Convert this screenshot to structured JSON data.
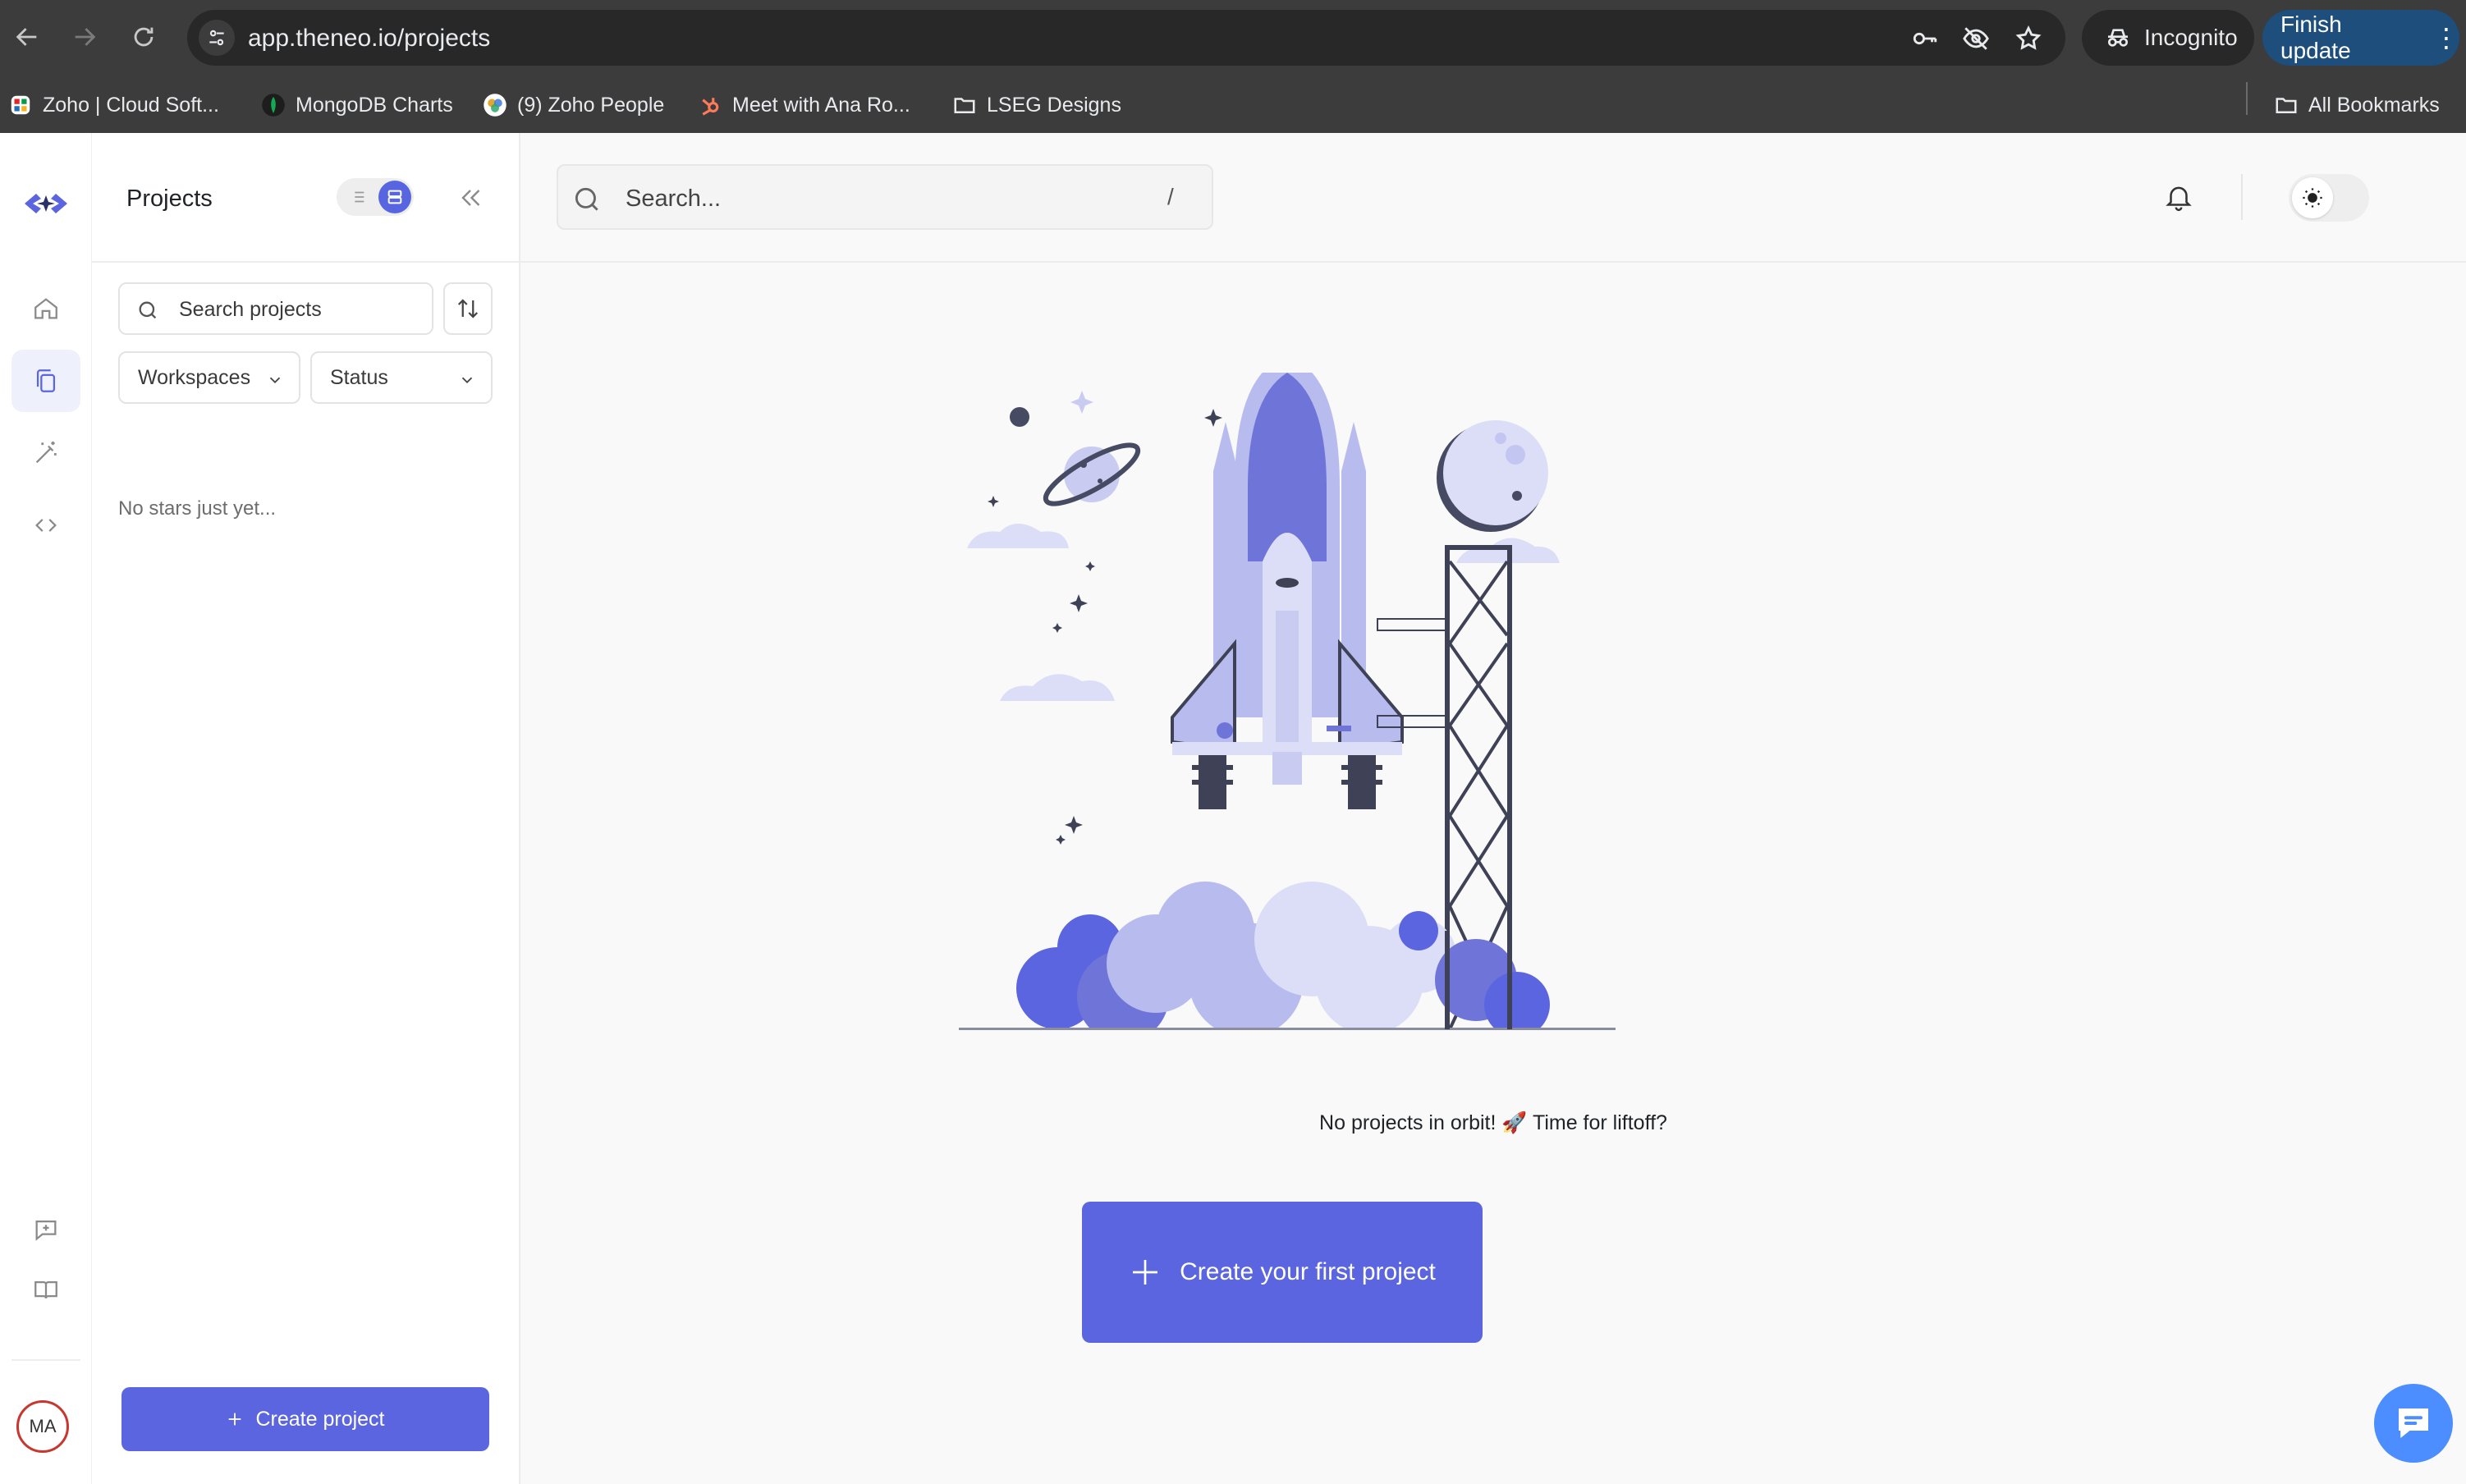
{
  "browser": {
    "url": "app.theneo.io/projects",
    "incognito_label": "Incognito",
    "finish_update_label": "Finish update",
    "bookmarks": [
      {
        "label": "Zoho | Cloud Soft...",
        "icon": "zoho-icon"
      },
      {
        "label": "MongoDB Charts",
        "icon": "mongodb-icon"
      },
      {
        "label": "(9) Zoho People",
        "icon": "zoho-people-icon"
      },
      {
        "label": "Meet with Ana Ro...",
        "icon": "hubspot-icon"
      },
      {
        "label": "LSEG Designs",
        "icon": "folder-icon"
      }
    ],
    "all_bookmarks_label": "All Bookmarks"
  },
  "sidebar_panel": {
    "title": "Projects",
    "search_placeholder": "Search projects",
    "filters": {
      "workspaces": "Workspaces",
      "status": "Status"
    },
    "empty_stars": "No stars just yet...",
    "create_button": "Create project"
  },
  "main": {
    "search_placeholder": "Search...",
    "search_shortcut": "/",
    "empty_message": "No projects in orbit! 🚀 Time for liftoff?",
    "cta_label": "Create your first project"
  },
  "user": {
    "initials": "MA"
  },
  "colors": {
    "accent": "#5b65e0",
    "illustration_primary": "#6f75d8",
    "illustration_light": "#b8bbee",
    "illustration_dark": "#3f4257",
    "finish_update_bg": "#1e4e7c",
    "chat_fab": "#4c8dff"
  }
}
